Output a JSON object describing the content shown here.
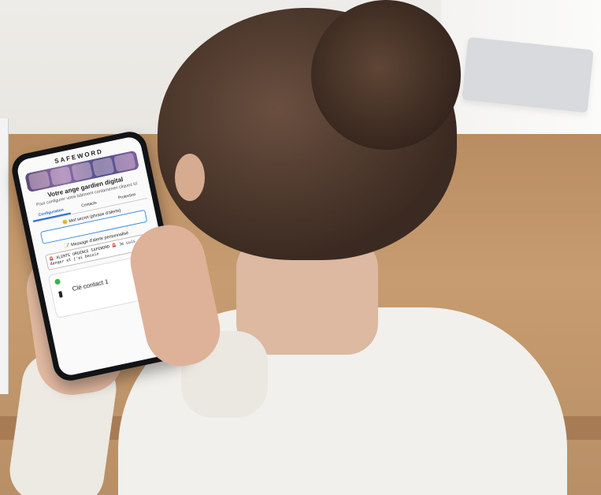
{
  "app": {
    "name": "SAFEWORD",
    "headline": "Votre ange gardien digital",
    "subline": "Pour configurer votre bâtiment contamenen cliquez ici",
    "tabs": [
      {
        "label": "Configuration",
        "active": true
      },
      {
        "label": "Contacts",
        "active": false
      },
      {
        "label": "Protection",
        "active": false
      }
    ],
    "secret_label": "😊 Mot secret (phrase d'alerte)",
    "message_label": "📝 Message d'alerte personnalisé",
    "message_text": "🚨 ALERTE URGENCE SAFEWORD 🚨 Je suis en danger et j'ai besoin",
    "contact_card_label": "Clé contact 1",
    "accent_color": "#2a6fd1",
    "status_color": "#36b24a"
  }
}
